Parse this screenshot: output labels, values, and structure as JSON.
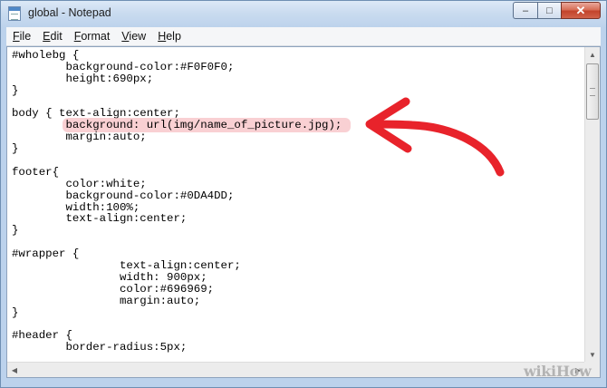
{
  "window": {
    "title": "global - Notepad",
    "minimize_glyph": "–",
    "maximize_glyph": "□",
    "close_glyph": "✕"
  },
  "menu": [
    {
      "underlined": "F",
      "rest": "ile"
    },
    {
      "underlined": "E",
      "rest": "dit"
    },
    {
      "underlined": "F",
      "rest": "ormat",
      "prefix": "",
      "alt": "Format"
    },
    {
      "underlined": "V",
      "rest": "iew"
    },
    {
      "underlined": "H",
      "rest": "elp"
    }
  ],
  "code_lines": [
    "#wholebg {",
    "        background-color:#F0F0F0;",
    "        height:690px;",
    "}",
    "",
    "body { text-align:center;",
    "        background: url(img/name_of_picture.jpg);",
    "        margin:auto;",
    "}",
    "",
    "footer{",
    "        color:white;",
    "        background-color:#0DA4DD;",
    "        width:100%;",
    "        text-align:center;",
    "}",
    "",
    "#wrapper {",
    "                text-align:center;",
    "                width: 900px;",
    "                color:#696969;",
    "                margin:auto;",
    "}",
    "",
    "#header {",
    "        border-radius:5px;"
  ],
  "highlighted_line_index": 6,
  "annotation": {
    "color": "#e8232b",
    "icon": "red-arrow-icon"
  },
  "watermark": {
    "text": "wikiHow",
    "color": "#b3b3b3"
  }
}
